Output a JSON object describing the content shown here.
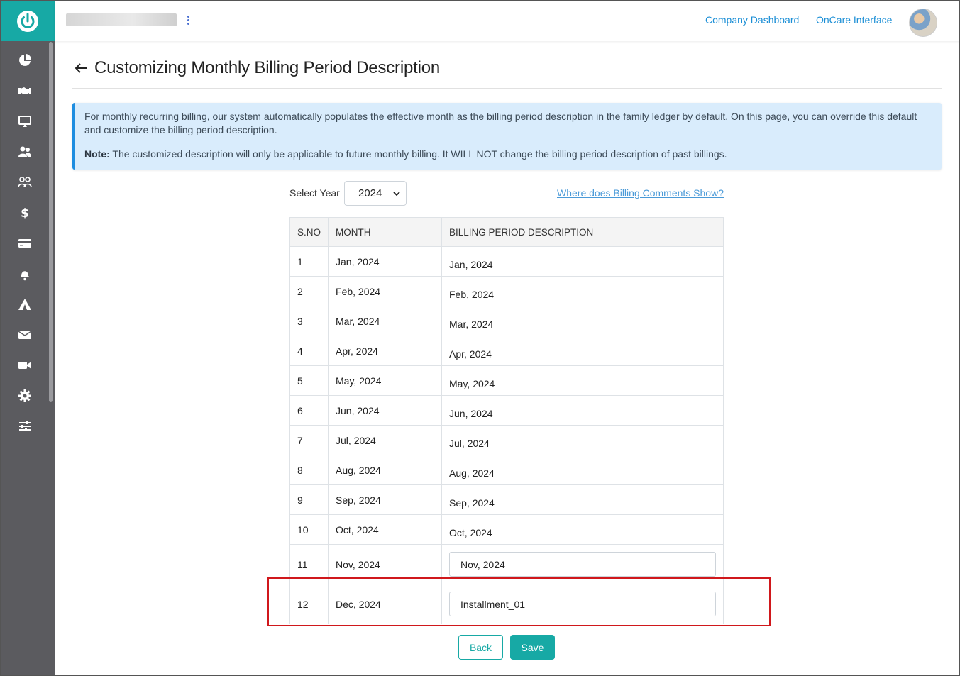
{
  "header": {
    "company_name": "",
    "links": [
      "Company Dashboard",
      "OnCare Interface"
    ]
  },
  "sidebar": {
    "icons": [
      "pie-chart-icon",
      "handshake-icon",
      "monitor-icon",
      "users-icon",
      "family-icon",
      "dollar-icon",
      "credit-card-icon",
      "bell-user-icon",
      "camp-icon",
      "envelope-icon",
      "video-icon",
      "gear-icon",
      "sliders-icon"
    ]
  },
  "page": {
    "title": "Customizing Monthly Billing Period Description"
  },
  "info": {
    "line1": "For monthly recurring billing, our system automatically populates the effective month as the billing period description in the family ledger by default. On this page, you can override this default and customize the billing period description.",
    "note_label": "Note:",
    "note_text": " The customized description will only be applicable to future monthly billing. It WILL NOT change the billing period description of past billings."
  },
  "controls": {
    "select_year_label": "Select Year",
    "year_value": "2024",
    "help_link": "Where does Billing Comments Show?"
  },
  "table": {
    "headers": [
      "S.NO",
      "MONTH",
      "BILLING PERIOD DESCRIPTION"
    ],
    "rows": [
      {
        "sno": "1",
        "month": "Jan, 2024",
        "desc": "Jan, 2024"
      },
      {
        "sno": "2",
        "month": "Feb, 2024",
        "desc": "Feb, 2024"
      },
      {
        "sno": "3",
        "month": "Mar, 2024",
        "desc": "Mar, 2024"
      },
      {
        "sno": "4",
        "month": "Apr, 2024",
        "desc": "Apr, 2024"
      },
      {
        "sno": "5",
        "month": "May, 2024",
        "desc": "May, 2024"
      },
      {
        "sno": "6",
        "month": "Jun, 2024",
        "desc": "Jun, 2024"
      },
      {
        "sno": "7",
        "month": "Jul, 2024",
        "desc": "Jul, 2024"
      },
      {
        "sno": "8",
        "month": "Aug, 2024",
        "desc": "Aug, 2024"
      },
      {
        "sno": "9",
        "month": "Sep, 2024",
        "desc": "Sep, 2024"
      },
      {
        "sno": "10",
        "month": "Oct, 2024",
        "desc": "Oct, 2024"
      },
      {
        "sno": "11",
        "month": "Nov, 2024",
        "desc": "Nov, 2024"
      },
      {
        "sno": "12",
        "month": "Dec, 2024",
        "desc": "Installment_01"
      }
    ]
  },
  "buttons": {
    "back": "Back",
    "save": "Save"
  },
  "colors": {
    "accent": "#17a9a5",
    "sidebar": "#5b5b5f",
    "link": "#1c8fd6",
    "highlight": "#d0181c",
    "info_bg": "#d9ecfc"
  }
}
